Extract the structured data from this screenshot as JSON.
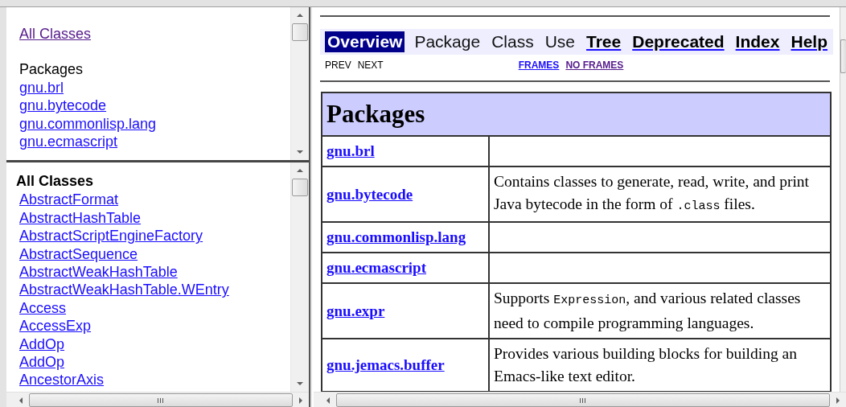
{
  "package_frame": {
    "all_classes_link": {
      "label": "All Classes",
      "visited": true
    },
    "heading": "Packages",
    "packages": [
      {
        "label": "gnu.brl"
      },
      {
        "label": "gnu.bytecode"
      },
      {
        "label": "gnu.commonlisp.lang"
      },
      {
        "label": "gnu.ecmascript"
      }
    ]
  },
  "class_frame": {
    "heading": "All Classes",
    "classes": [
      {
        "label": "AbstractFormat"
      },
      {
        "label": "AbstractHashTable"
      },
      {
        "label": "AbstractScriptEngineFactory"
      },
      {
        "label": "AbstractSequence"
      },
      {
        "label": "AbstractWeakHashTable"
      },
      {
        "label": "AbstractWeakHashTable.WEntry"
      },
      {
        "label": "Access"
      },
      {
        "label": "AccessExp"
      },
      {
        "label": "AddOp"
      },
      {
        "label": "AddOp"
      },
      {
        "label": "AncestorAxis"
      }
    ]
  },
  "main_frame": {
    "nav": [
      {
        "label": "Overview",
        "selected": true,
        "link": false
      },
      {
        "label": "Package",
        "selected": false,
        "link": false
      },
      {
        "label": "Class",
        "selected": false,
        "link": false
      },
      {
        "label": "Use",
        "selected": false,
        "link": false
      },
      {
        "label": "Tree",
        "selected": false,
        "link": true
      },
      {
        "label": "Deprecated",
        "selected": false,
        "link": true
      },
      {
        "label": "Index",
        "selected": false,
        "link": true
      },
      {
        "label": "Help",
        "selected": false,
        "link": true
      }
    ],
    "subnav": [
      {
        "label": "PREV",
        "kind": "text"
      },
      {
        "label": "NEXT",
        "kind": "text"
      },
      {
        "label": "FRAMES",
        "kind": "link",
        "visited": false
      },
      {
        "label": "NO FRAMES",
        "kind": "link",
        "visited": true
      }
    ],
    "table": {
      "title": "Packages",
      "rows": [
        {
          "package": "gnu.brl"
        },
        {
          "package": "gnu.bytecode",
          "description": [
            {
              "kind": "text",
              "text": "Contains classes to generate, read, write, and print Java bytecode in the form of "
            },
            {
              "kind": "code",
              "text": ".class"
            },
            {
              "kind": "text",
              "text": " files."
            }
          ]
        },
        {
          "package": "gnu.commonlisp.lang"
        },
        {
          "package": "gnu.ecmascript"
        },
        {
          "package": "gnu.expr",
          "description": [
            {
              "kind": "text",
              "text": "Supports "
            },
            {
              "kind": "code",
              "text": "Expression"
            },
            {
              "kind": "text",
              "text": ", and various related classes need to compile programming languages."
            }
          ]
        },
        {
          "package": "gnu.jemacs.buffer",
          "description": [
            {
              "kind": "text",
              "text": "Provides various building blocks for building an Emacs-like text editor."
            }
          ]
        }
      ]
    }
  }
}
